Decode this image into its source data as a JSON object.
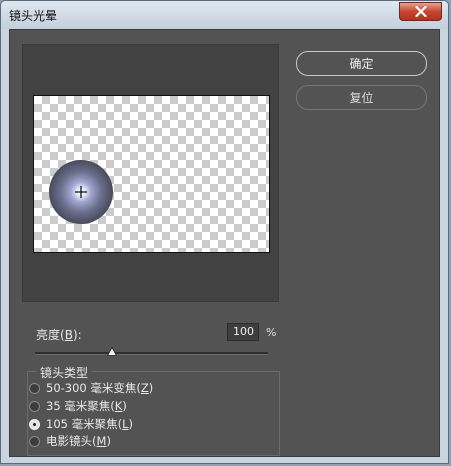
{
  "window": {
    "title": "镜头光晕"
  },
  "buttons": {
    "ok_label": "确定",
    "reset_label": "复位"
  },
  "brightness": {
    "label": "亮度",
    "mnemonic": "B",
    "value": "100",
    "unit": "%",
    "slider_fraction": 0.33
  },
  "lens_type": {
    "group_label": "镜头类型",
    "options": [
      {
        "label": "50-300 毫米变焦",
        "mnemonic": "Z",
        "selected": false
      },
      {
        "label": "35 毫米聚焦",
        "mnemonic": "K",
        "selected": false
      },
      {
        "label": "105 毫米聚焦",
        "mnemonic": "L",
        "selected": true
      },
      {
        "label": "电影镜头",
        "mnemonic": "M",
        "selected": false
      }
    ]
  },
  "colors": {
    "dialog_bg": "#535353",
    "preview_bg": "#424242",
    "close_red": "#c8452e"
  },
  "icons": {
    "close": "close-icon",
    "flare": "flare-crosshair-icon"
  }
}
